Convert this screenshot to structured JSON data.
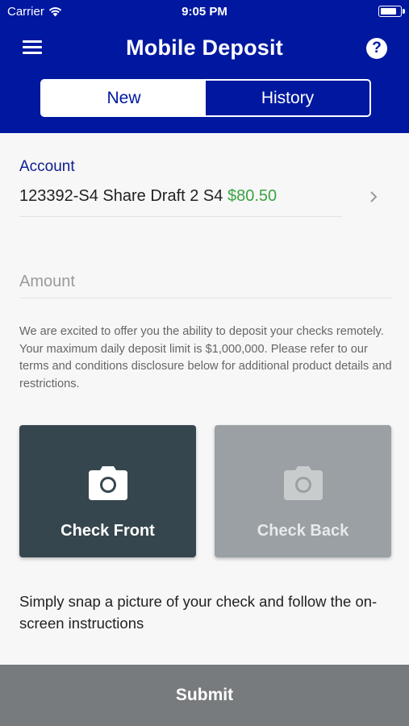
{
  "status_bar": {
    "carrier": "Carrier",
    "time": "9:05 PM"
  },
  "header": {
    "title": "Mobile Deposit"
  },
  "tabs": [
    {
      "label": "New",
      "active": true
    },
    {
      "label": "History",
      "active": false
    }
  ],
  "account": {
    "label": "Account",
    "name": "123392-S4 Share Draft 2 S4",
    "balance": "$80.50"
  },
  "amount": {
    "placeholder": "Amount",
    "value": ""
  },
  "disclaimer": "We are excited to offer you the ability to deposit your checks remotely. Your maximum daily deposit limit is $1,000,000. Please refer to our terms and conditions disclosure below for additional product details and restrictions.",
  "checks": {
    "front_label": "Check Front",
    "back_label": "Check Back"
  },
  "instructions": "Simply snap a picture of your check and follow the on-screen instructions",
  "submit_label": "Submit",
  "colors": {
    "header_bg": "#0018a0",
    "balance_green": "#3aa343",
    "check_front_bg": "#36464e",
    "check_back_bg": "#9aa0a3",
    "submit_bg": "#777b7d"
  },
  "icons": [
    "wifi-icon",
    "battery-icon",
    "menu-icon",
    "help-icon",
    "chevron-right-icon",
    "camera-icon"
  ]
}
